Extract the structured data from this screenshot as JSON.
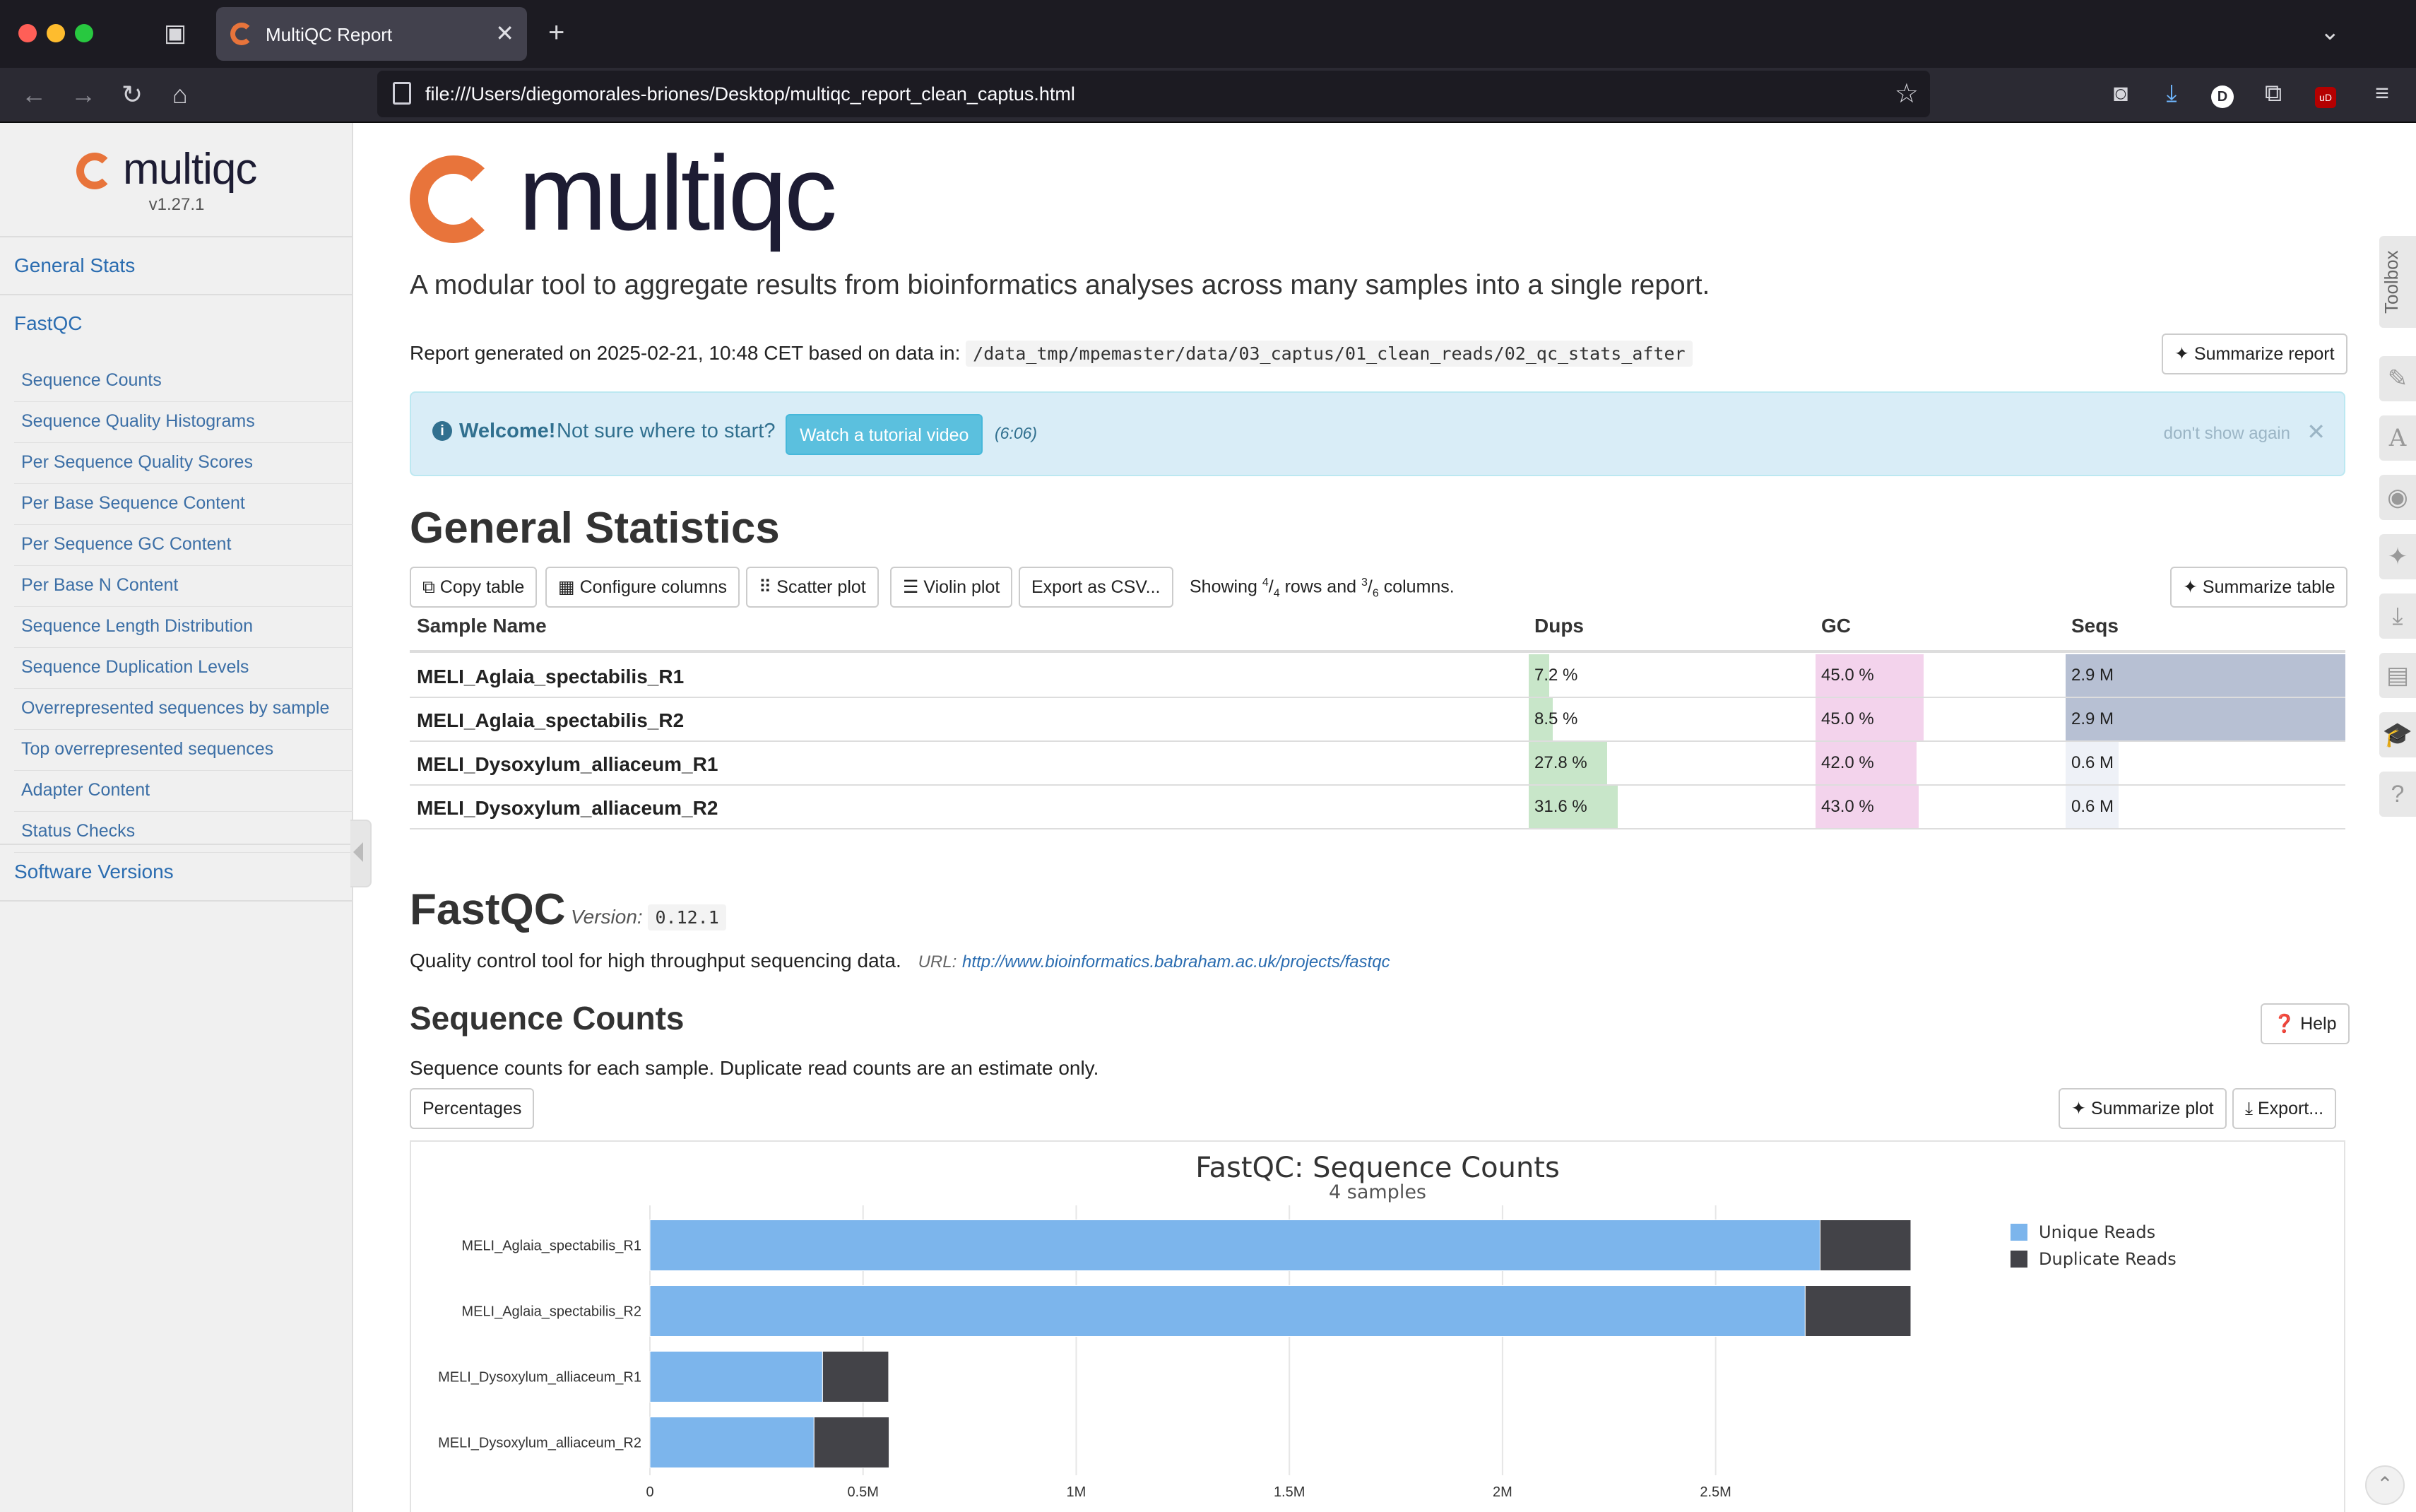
{
  "browser": {
    "tab_title": "MultiQC Report",
    "url": "file:///Users/diegomorales-briones/Desktop/multiqc_report_clean_captus.html"
  },
  "sidebar": {
    "logo_text": "multiqc",
    "version": "v1.27.1",
    "general_stats": "General Stats",
    "fastqc": "FastQC",
    "items": [
      "Sequence Counts",
      "Sequence Quality Histograms",
      "Per Sequence Quality Scores",
      "Per Base Sequence Content",
      "Per Sequence GC Content",
      "Per Base N Content",
      "Sequence Length Distribution",
      "Sequence Duplication Levels",
      "Overrepresented sequences by sample",
      "Top overrepresented sequences",
      "Adapter Content",
      "Status Checks"
    ],
    "software_versions": "Software Versions"
  },
  "header": {
    "logo_text": "multiqc",
    "tagline": "A modular tool to aggregate results from bioinformatics analyses across many samples into a single report.",
    "report_generated": "Report generated on 2025-02-21, 10:48 CET based on data in:",
    "data_path": "/data_tmp/mpemaster/data/03_captus/01_clean_reads/02_qc_stats_after",
    "summarize_report": "Summarize report"
  },
  "welcome": {
    "title": "Welcome!",
    "text": "Not sure where to start?",
    "button": "Watch a tutorial video",
    "duration": "(6:06)",
    "dismiss": "don't show again"
  },
  "general_stats": {
    "title": "General Statistics",
    "buttons": {
      "copy": "Copy table",
      "configure": "Configure columns",
      "scatter": "Scatter plot",
      "violin": "Violin plot",
      "export": "Export as CSV...",
      "summarize": "Summarize table"
    },
    "showing_prefix": "Showing",
    "rows_num": "4",
    "rows_den": "4",
    "rows_word": "rows and",
    "cols_num": "3",
    "cols_den": "6",
    "cols_word": "columns.",
    "columns": [
      "Sample Name",
      "Dups",
      "GC",
      "Seqs"
    ],
    "rows": [
      {
        "name": "MELI_Aglaia_spectabilis_R1",
        "dups": "7.2 %",
        "gc": "45.0 %",
        "seqs": "2.9 M",
        "dups_frac": 0.072,
        "gc_frac": 0.45,
        "seqs_frac": 1.0
      },
      {
        "name": "MELI_Aglaia_spectabilis_R2",
        "dups": "8.5 %",
        "gc": "45.0 %",
        "seqs": "2.9 M",
        "dups_frac": 0.085,
        "gc_frac": 0.45,
        "seqs_frac": 1.0
      },
      {
        "name": "MELI_Dysoxylum_alliaceum_R1",
        "dups": "27.8 %",
        "gc": "42.0 %",
        "seqs": "0.6 M",
        "dups_frac": 0.278,
        "gc_frac": 0.42,
        "seqs_frac": 0.19
      },
      {
        "name": "MELI_Dysoxylum_alliaceum_R2",
        "dups": "31.6 %",
        "gc": "43.0 %",
        "seqs": "0.6 M",
        "dups_frac": 0.316,
        "gc_frac": 0.43,
        "seqs_frac": 0.19
      }
    ]
  },
  "fastqc": {
    "title": "FastQC",
    "version_label": "Version:",
    "version": "0.12.1",
    "desc": "Quality control tool for high throughput sequencing data.",
    "url_label": "URL:",
    "url": "http://www.bioinformatics.babraham.ac.uk/projects/fastqc"
  },
  "sequence_counts": {
    "title": "Sequence Counts",
    "help": "Help",
    "desc": "Sequence counts for each sample. Duplicate read counts are an estimate only.",
    "percentages": "Percentages",
    "summarize_plot": "Summarize plot",
    "export": "Export..."
  },
  "chart_data": {
    "type": "bar",
    "orientation": "horizontal",
    "stacked": true,
    "title": "FastQC: Sequence Counts",
    "subtitle": "4 samples",
    "categories": [
      "MELI_Aglaia_spectabilis_R1",
      "MELI_Aglaia_spectabilis_R2",
      "MELI_Dysoxylum_alliaceum_R1",
      "MELI_Dysoxylum_alliaceum_R2"
    ],
    "series": [
      {
        "name": "Unique Reads",
        "color": "#7cb5ec",
        "values": [
          2745000,
          2710000,
          405000,
          385000
        ]
      },
      {
        "name": "Duplicate Reads",
        "color": "#434348",
        "values": [
          213000,
          248000,
          155000,
          176000
        ]
      }
    ],
    "xlim": [
      0,
      2900000
    ],
    "xticks": [
      0,
      500000,
      1000000,
      1500000,
      2000000,
      2500000
    ],
    "xtick_labels": [
      "0",
      "0.5M",
      "1M",
      "1.5M",
      "2M",
      "2.5M"
    ],
    "legend_position": "top-right",
    "grid": true
  },
  "toolbox": {
    "label": "Toolbox"
  },
  "colors": {
    "link": "#2a6cb0",
    "brand_orange": "#e8743b",
    "dups_bar": "#c8e6c9",
    "gc_bar": "#f3d3ec",
    "seqs_bar": "#b7c0d3",
    "welcome_bg": "#d9edf7"
  }
}
